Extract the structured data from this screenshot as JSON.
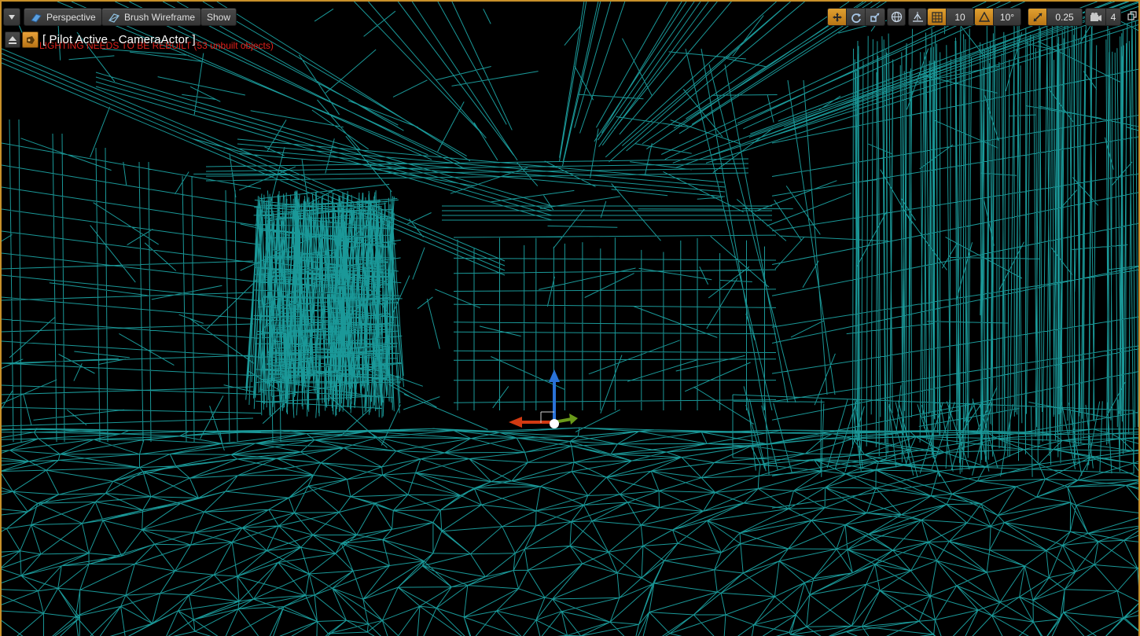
{
  "toolbar": {
    "menu_icon": "chevron-down-icon",
    "view_mode": {
      "label": "Perspective",
      "icon": "perspective-cube-icon"
    },
    "view_mode_render": {
      "label": "Brush Wireframe",
      "icon": "wireframe-icon"
    },
    "show": {
      "label": "Show"
    },
    "transform_tools": [
      "translate-icon",
      "rotate-icon",
      "scale-icon"
    ],
    "coordinate_system_icon": "world-globe-icon",
    "surface_snapping_icon": "surface-snap-icon",
    "grid_snap": {
      "icon": "grid-icon",
      "value": "10"
    },
    "rotation_snap": {
      "icon": "angle-icon",
      "value": "10°"
    },
    "scale_snap": {
      "icon": "scale-arrow-icon",
      "value": "0.25"
    },
    "camera_speed": {
      "icon": "camera-icon",
      "value": "4"
    },
    "restore_icon": "restore-window-icon"
  },
  "viewport": {
    "pilot_label": "[ Pilot Active - CameraActor ]",
    "warning": "LIGHTING NEEDS TO BE REBUILT (53 unbuilt objects)",
    "eject_icon": "eject-icon",
    "pilot_icon": "camera-pilot-icon",
    "wire_color": "#1a9898",
    "border_color": "#c8902a",
    "warning_color": "#e0201b",
    "gizmo_axes": {
      "x": "#d23a12",
      "y": "#6a9a1a",
      "z": "#2a72d8"
    }
  }
}
